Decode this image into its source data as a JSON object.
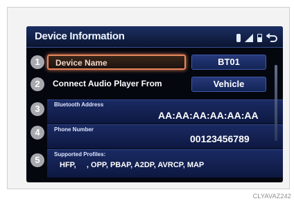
{
  "header": {
    "title": "Device Information"
  },
  "status_icons": [
    "bluetooth-icon",
    "signal-icon",
    "battery-icon",
    "back-icon"
  ],
  "rows": [
    {
      "number": "1",
      "label": "Device Name",
      "value": "BT01"
    },
    {
      "number": "2",
      "label": "Connect Audio Player From",
      "value": "Vehicle"
    },
    {
      "number": "3",
      "label": "Bluetooth Address",
      "value": "AA:AA:AA:AA:AA:AA"
    },
    {
      "number": "4",
      "label": "Phone Number",
      "value": "00123456789"
    },
    {
      "number": "5",
      "label": "Supported Profiles:",
      "value": "HFP,     , OPP, PBAP, A2DP, AVRCP, MAP"
    }
  ],
  "caption": "CLYAVAZ242",
  "colors": {
    "accent_highlight": "#e8875e",
    "title_bar": "#1c2f63",
    "background": "#05070f"
  }
}
